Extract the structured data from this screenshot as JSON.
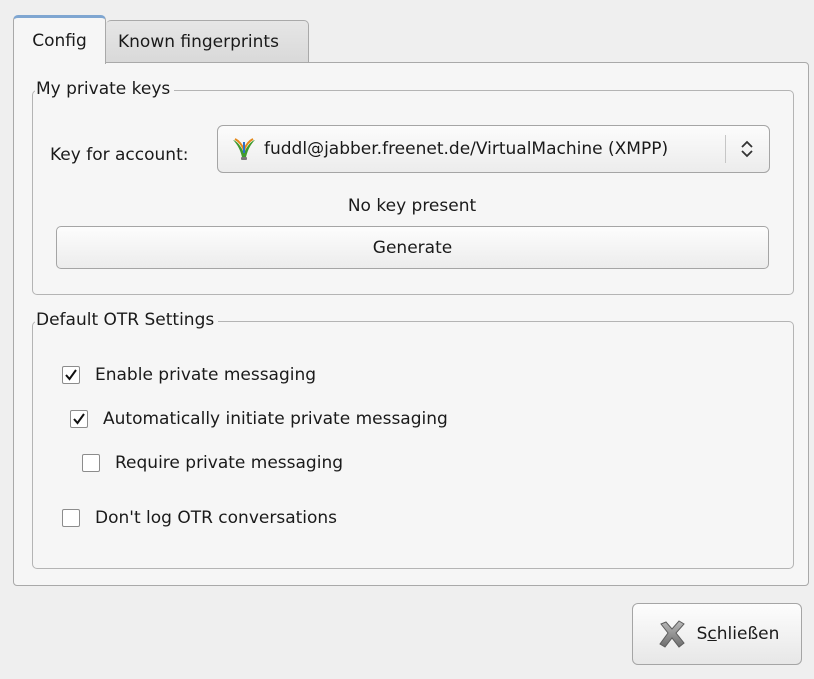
{
  "tabs": [
    {
      "label": "Config",
      "active": true
    },
    {
      "label": "Known fingerprints",
      "active": false
    }
  ],
  "private_keys": {
    "title": "My private keys",
    "key_for_account_label": "Key for account:",
    "account": {
      "value": "fuddl@jabber.freenet.de/VirtualMachine (XMPP)",
      "icon": "jabber-bulb-icon"
    },
    "status": "No key present",
    "generate_label": "Generate"
  },
  "otr_settings": {
    "title": "Default OTR Settings",
    "options": [
      {
        "label": "Enable private messaging",
        "checked": true
      },
      {
        "label": "Automatically initiate private messaging",
        "checked": true
      },
      {
        "label": "Require private messaging",
        "checked": false
      },
      {
        "label": "Don't log OTR conversations",
        "checked": false
      }
    ]
  },
  "close_button": {
    "label_prefix": "S",
    "label_mnemonic": "c",
    "label_suffix": "hließen",
    "icon": "close-x-icon"
  },
  "colors": {
    "active_tab_accent": "#7fa6d1",
    "window_bg": "#efefef",
    "panel_bg": "#f6f6f6"
  }
}
